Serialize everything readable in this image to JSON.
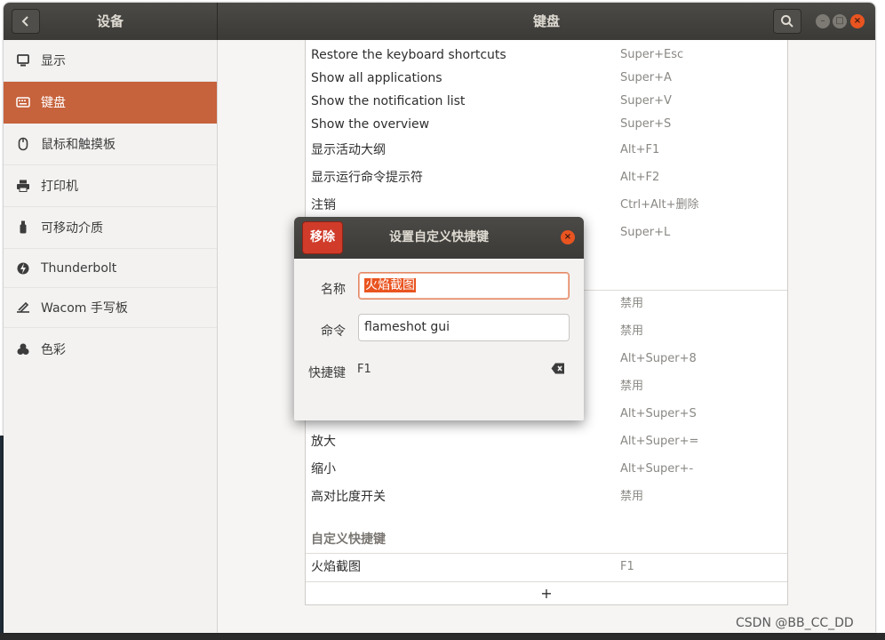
{
  "window": {
    "left_title": "设备",
    "right_title": "键盘"
  },
  "sidebar": {
    "items": [
      {
        "label": "显示",
        "icon": "display-icon",
        "active": false
      },
      {
        "label": "键盘",
        "icon": "keyboard-icon",
        "active": true
      },
      {
        "label": "鼠标和触摸板",
        "icon": "mouse-icon",
        "active": false
      },
      {
        "label": "打印机",
        "icon": "printer-icon",
        "active": false
      },
      {
        "label": "可移动介质",
        "icon": "removable-media-icon",
        "active": false
      },
      {
        "label": "Thunderbolt",
        "icon": "thunderbolt-icon",
        "active": false
      },
      {
        "label": "Wacom 手写板",
        "icon": "tablet-icon",
        "active": false
      },
      {
        "label": "色彩",
        "icon": "color-icon",
        "active": false
      }
    ]
  },
  "shortcuts": {
    "rows": [
      {
        "name": "Restore the keyboard shortcuts",
        "key": "Super+Esc"
      },
      {
        "name": "Show all applications",
        "key": "Super+A"
      },
      {
        "name": "Show the notification list",
        "key": "Super+V"
      },
      {
        "name": "Show the overview",
        "key": "Super+S"
      },
      {
        "name": "显示活动大纲",
        "key": "Alt+F1"
      },
      {
        "name": "显示运行命令提示符",
        "key": "Alt+F2"
      },
      {
        "name": "注销",
        "key": "Ctrl+Alt+删除"
      },
      {
        "name": "",
        "key": "Super+L"
      }
    ],
    "partial_rows": [
      {
        "name": "",
        "key": "禁用"
      },
      {
        "name": "",
        "key": "禁用"
      },
      {
        "name": "",
        "key": "Alt+Super+8"
      },
      {
        "name": "",
        "key": "禁用"
      },
      {
        "name": "",
        "key": "Alt+Super+S"
      },
      {
        "name": "放大",
        "key": "Alt+Super+="
      },
      {
        "name": "缩小",
        "key": "Alt+Super+-"
      },
      {
        "name": "高对比度开关",
        "key": "禁用"
      }
    ],
    "custom_section_title": "自定义快捷键",
    "custom_rows": [
      {
        "name": "火焰截图",
        "key": "F1"
      }
    ],
    "add_label": "+"
  },
  "dialog": {
    "remove_label": "移除",
    "title": "设置自定义快捷键",
    "name_label": "名称",
    "name_value": "火焰截图",
    "command_label": "命令",
    "command_value": "flameshot gui",
    "shortcut_label": "快捷键",
    "shortcut_value": "F1"
  },
  "watermark": "CSDN @BB_CC_DD",
  "colors": {
    "accent": "#c6623c",
    "close": "#e95420",
    "remove": "#d03b2a",
    "titlebar": "#3b3a37"
  }
}
